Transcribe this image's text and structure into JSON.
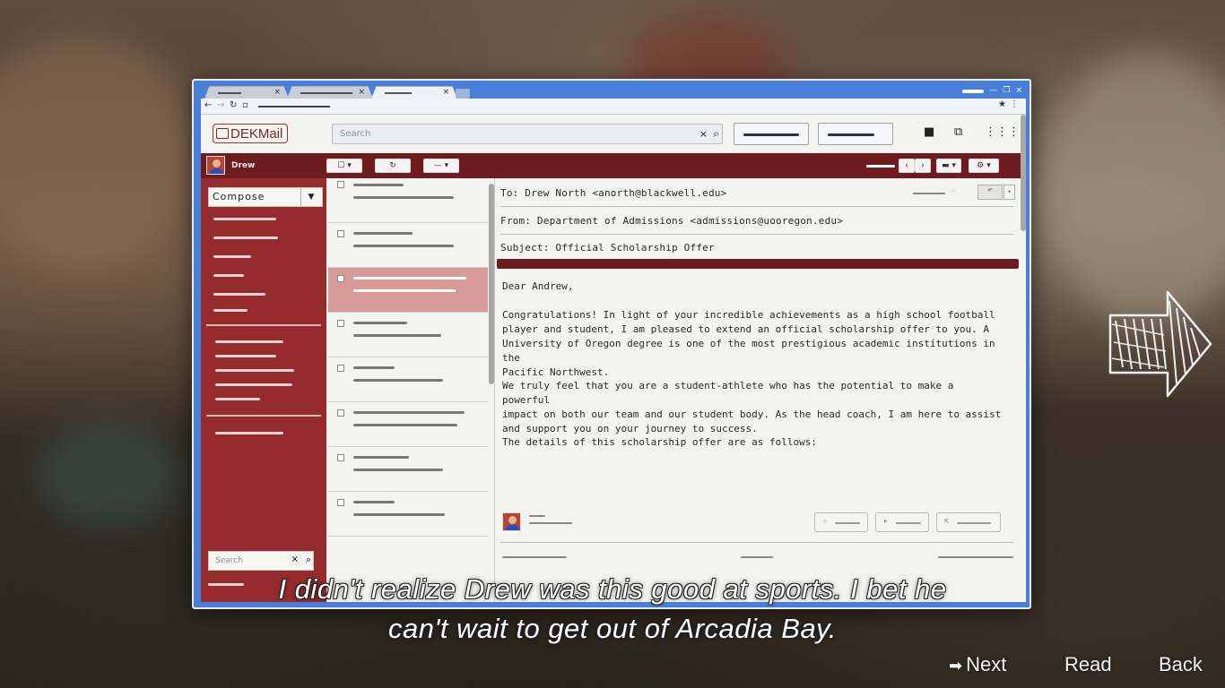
{
  "browser": {
    "tabs": [
      {
        "label": "",
        "close": "×"
      },
      {
        "label": "",
        "close": "×"
      },
      {
        "label": "",
        "close": "×"
      }
    ],
    "window_controls": [
      "—",
      "❐",
      "×"
    ]
  },
  "mail": {
    "logo": "DEKMail",
    "search_placeholder": "Search",
    "search_clear": "×",
    "user": {
      "name": "Drew"
    },
    "compose_label": "Compose",
    "sidebar_search_placeholder": "Search"
  },
  "email": {
    "to": "To: Drew North <anorth@blackwell.edu>",
    "from": "From: Department of Admissions <admissions@uooregon.edu>",
    "subject": "Subject: Official Scholarship Offer",
    "greeting": "Dear Andrew,",
    "paragraphs": [
      "Congratulations! In light of your incredible achievements as a high school football\nplayer and student, I am pleased to extend an official scholarship offer to you. A\nUniversity of Oregon degree is one of the most prestigious academic institutions in the\nPacific Northwest.",
      "We truly feel that you are a student-athlete who has the potential to make a powerful\nimpact on both our team and our student body. As the head coach, I am here to assist\nand support you on your journey to success.",
      "The details of this scholarship offer are as follows:"
    ]
  },
  "subtitle": {
    "line1": "I didn't realize Drew was this good at sports. I bet he",
    "line2": "can't wait to get out of Arcadia Bay."
  },
  "bottom_nav": {
    "next": "Next",
    "read": "Read",
    "back": "Back"
  }
}
